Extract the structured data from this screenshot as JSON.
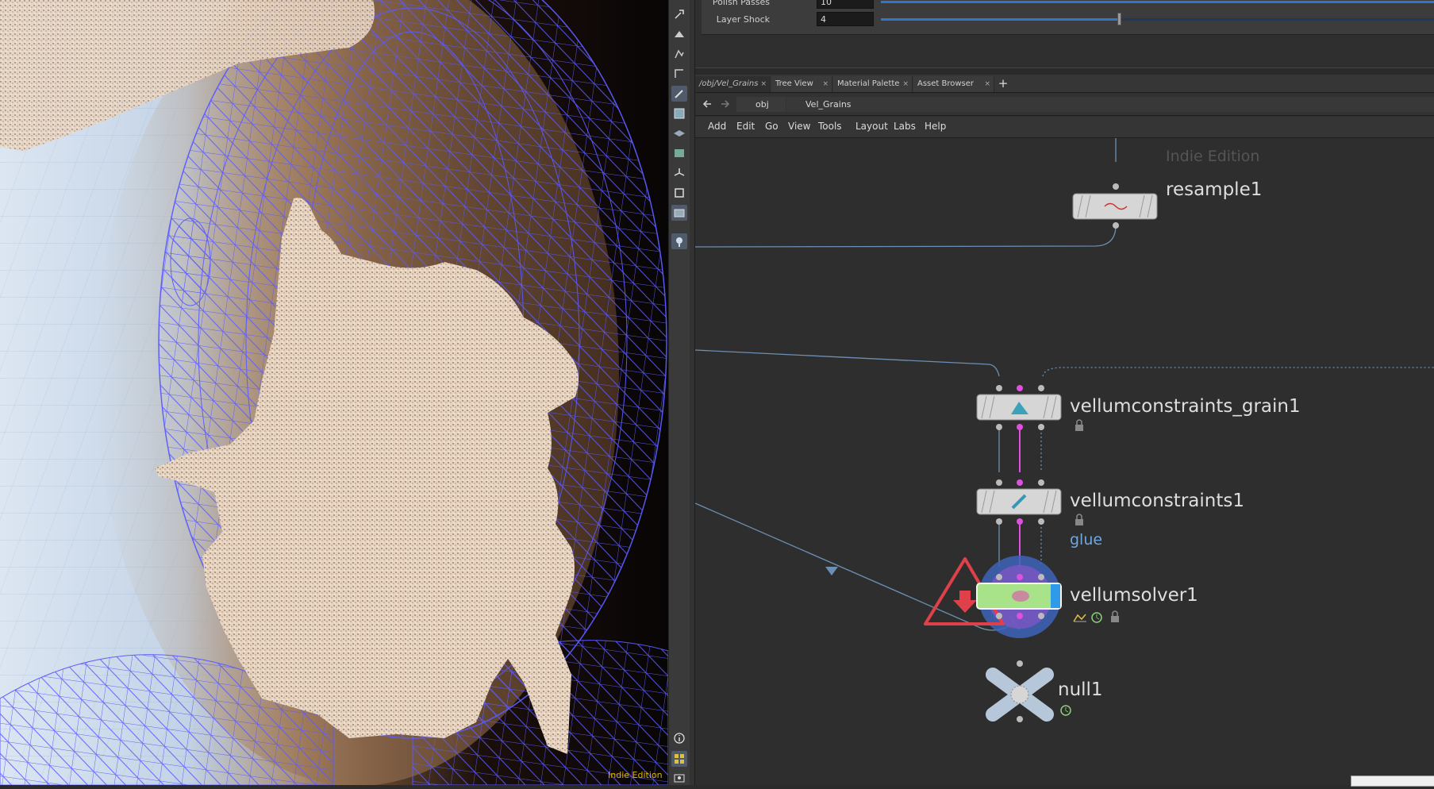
{
  "parameters": [
    {
      "label": "Polish Passes",
      "value": "10",
      "slider_fraction": 1.0
    },
    {
      "label": "Layer Shock",
      "value": "4",
      "slider_fraction": 0.43
    }
  ],
  "tabs": [
    {
      "label": "/obj/Vel_Grains",
      "active": true
    },
    {
      "label": "Tree View",
      "active": false
    },
    {
      "label": "Material Palette",
      "active": false
    },
    {
      "label": "Asset Browser",
      "active": false
    }
  ],
  "tab_close_glyph": "×",
  "tab_add_glyph": "+",
  "path": {
    "root": "obj",
    "current": "Vel_Grains"
  },
  "menu": [
    "Add",
    "Edit",
    "Go",
    "View",
    "Tools",
    "Layout",
    "Labs",
    "Help"
  ],
  "network": {
    "watermark": "Indie Edition",
    "nodes": [
      {
        "name": "resample1",
        "icon": "resample-icon",
        "flags": []
      },
      {
        "name": "vellumconstraints_grain1",
        "icon": "grain-icon",
        "flags": [
          "lock-icon"
        ]
      },
      {
        "name": "vellumconstraints1",
        "icon": "pin-icon",
        "flags": [
          "lock-icon"
        ],
        "comment": "glue"
      },
      {
        "name": "vellumsolver1",
        "icon": "solver-icon",
        "flags": [
          "graph-icon",
          "clock-icon",
          "lock-icon"
        ],
        "display_flag": true,
        "warning": true
      },
      {
        "name": "null1",
        "icon": "null-icon",
        "flags": [
          "clock-icon"
        ]
      }
    ]
  },
  "viewport": {
    "watermark": "Indie Edition"
  },
  "colors": {
    "wireframe": "#5b5bff",
    "grains": "#d9c2a8",
    "bg_light": "#cfdcec",
    "accent_blue": "#2f78c9",
    "wire_pink": "#e050e0",
    "display_flag": "#2f9be8",
    "warning_red": "#e0404a",
    "node_green": "#a8e38a"
  },
  "tool_icons": [
    "select-icon",
    "view-icon",
    "pose-icon",
    "brush-icon",
    "pen-icon",
    "paint-icon",
    "layer-icon",
    "render-icon",
    "axis-icon",
    "box-icon",
    "camera-icon",
    "light-icon",
    "info-icon",
    "grid-icon",
    "snapshot-icon"
  ]
}
